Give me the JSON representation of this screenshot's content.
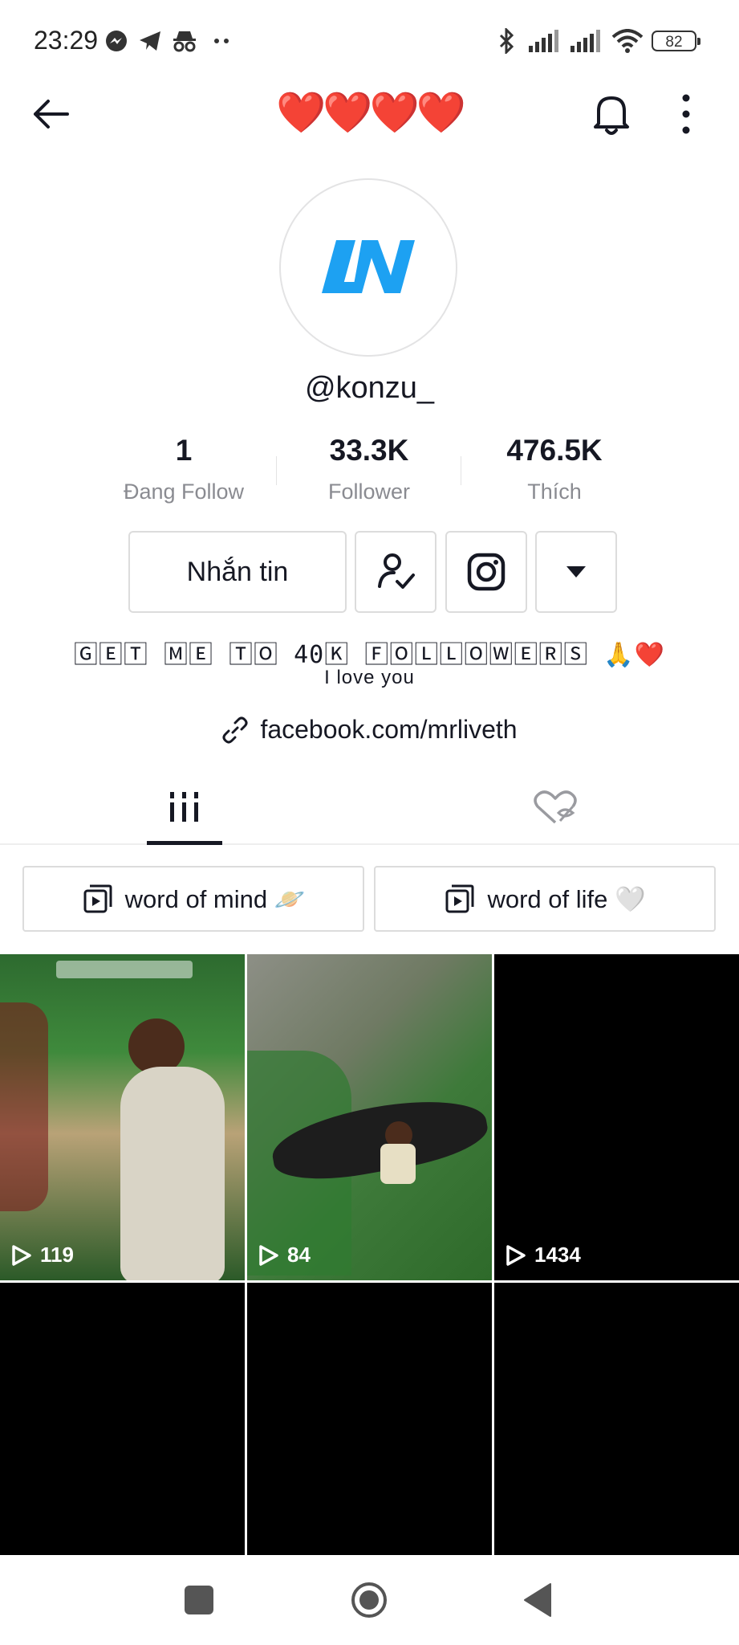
{
  "status_bar": {
    "time": "23:29",
    "battery": "82",
    "icons": [
      "messenger-icon",
      "telegram-icon",
      "incognito-icon",
      "more-dots-icon",
      "bluetooth-icon",
      "signal-icon",
      "signal-icon",
      "wifi-icon",
      "battery-icon"
    ]
  },
  "header": {
    "title": "❤️❤️❤️❤️",
    "back_icon": "back-arrow-icon",
    "bell_icon": "bell-icon",
    "menu_icon": "more-vertical-icon"
  },
  "profile": {
    "avatar_text": "LN",
    "username": "@konzu_",
    "stats": [
      {
        "value": "1",
        "label": "Đang Follow"
      },
      {
        "value": "33.3K",
        "label": "Follower"
      },
      {
        "value": "476.5K",
        "label": "Thích"
      }
    ],
    "message_button": "Nhắn tin",
    "bio_line1": "🄶🄴🅃 🄼🄴 🅃🄾 40🄺 🄵🄾🄻🄻🄾🅆🄴🅁🅂 🙏❤️",
    "bio_line2": "I love you",
    "link": "facebook.com/mrliveth"
  },
  "playlists": [
    {
      "label": "word of mind 🪐"
    },
    {
      "label": "word of life 🤍"
    }
  ],
  "videos": [
    {
      "views": "119"
    },
    {
      "views": "84"
    },
    {
      "views": "1434"
    },
    {
      "views": ""
    },
    {
      "views": ""
    },
    {
      "views": ""
    }
  ],
  "colors": {
    "accent": "#161823",
    "secondary_text": "#8a8b91",
    "heart": "#fe2c55",
    "logo_blue": "#1da1f2"
  }
}
